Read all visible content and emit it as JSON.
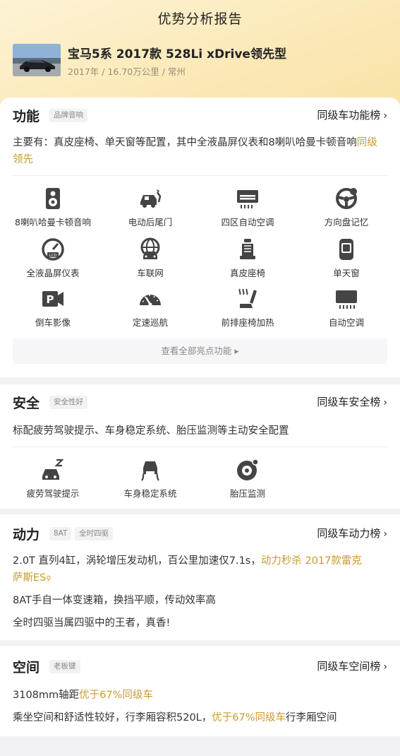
{
  "header": {
    "title": "优势分析报告",
    "car_name": "宝马5系 2017款 528Li xDrive领先型",
    "car_meta": "2017年 / 16.70万公里 / 常州"
  },
  "sections": {
    "function": {
      "title": "功能",
      "tag": "品牌音响",
      "rank_link": "同级车功能榜",
      "desc_main": "主要有：真皮座椅、单天窗等配置，其中全液晶屏仪表和8喇叭哈曼卡顿音响",
      "desc_highlight": "同级领先",
      "features": [
        {
          "label": "8喇叭哈曼卡顿音响",
          "icon": "speaker-icon"
        },
        {
          "label": "电动后尾门",
          "icon": "power-tailgate-icon"
        },
        {
          "label": "四区自动空调",
          "icon": "air-conditioner-icon"
        },
        {
          "label": "方向盘记忆",
          "icon": "steering-wheel-icon"
        },
        {
          "label": "全液晶屏仪表",
          "icon": "lcd-gauge-icon"
        },
        {
          "label": "车联网",
          "icon": "connected-car-icon"
        },
        {
          "label": "真皮座椅",
          "icon": "leather-seat-icon"
        },
        {
          "label": "单天窗",
          "icon": "sunroof-icon"
        },
        {
          "label": "倒车影像",
          "icon": "parking-camera-icon"
        },
        {
          "label": "定速巡航",
          "icon": "cruise-control-icon"
        },
        {
          "label": "前排座椅加热",
          "icon": "seat-heating-icon"
        },
        {
          "label": "自动空调",
          "icon": "auto-ac-icon"
        }
      ],
      "view_all": "查看全部亮点功能 ▸"
    },
    "safety": {
      "title": "安全",
      "tag": "安全性好",
      "rank_link": "同级车安全榜",
      "desc": "标配疲劳驾驶提示、车身稳定系统、胎压监测等主动安全配置",
      "features": [
        {
          "label": "疲劳驾驶提示",
          "icon": "fatigue-alert-icon"
        },
        {
          "label": "车身稳定系统",
          "icon": "stability-control-icon"
        },
        {
          "label": "胎压监测",
          "icon": "tire-pressure-icon"
        }
      ]
    },
    "power": {
      "title": "动力",
      "tags": [
        "8AT",
        "全时四驱"
      ],
      "rank_link": "同级车动力榜",
      "desc_line1_main": "2.0T 直列4缸，涡轮增压发动机，百公里加速仅7.1s，",
      "desc_line1_highlight": "动力秒杀 2017款雷克",
      "desc_line2_highlight": "萨斯ES",
      "desc_line3": "8AT手自一体变速箱，换挡平顺，传动效率高",
      "desc_line4": "全时四驱当属四驱中的王者，真香!"
    },
    "space": {
      "title": "空间",
      "tag": "老板键",
      "rank_link": "同级车空间榜",
      "line1_main": "3108mm轴距",
      "line1_highlight": "优于67%同级车",
      "line2_main": "乘坐空间和舒适性较好，行李厢容积520L，",
      "line2_highlight": "优于67%同级车",
      "line2_tail": "行李厢空间"
    }
  },
  "colors": {
    "accent": "#c99a2e",
    "header_bg": "#fbe9b8",
    "page_bg": "#f2f2f4"
  }
}
